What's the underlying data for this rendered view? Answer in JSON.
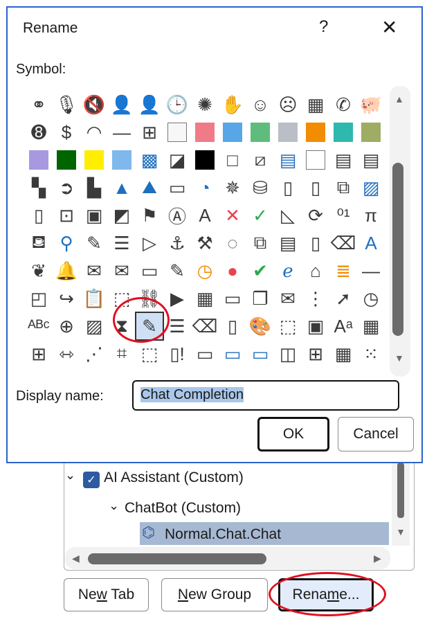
{
  "dialog": {
    "title": "Rename",
    "help": "?",
    "close": "✕",
    "symbol_label": "Symbol:",
    "display_name_label": "Display name:",
    "display_name_value": "Chat Completion",
    "ok": "OK",
    "cancel": "Cancel"
  },
  "symbols": [
    [
      "circles",
      "microphone",
      "mute",
      "user",
      "user-outline",
      "clock",
      "sparkle",
      "hand",
      "smile",
      "sad",
      "calculator",
      "phone",
      "piggy-bank"
    ],
    [
      "eight-ball",
      "quote-dollar",
      "eye",
      "dash",
      "four-squares",
      "#f7f7f7",
      "#f07b88",
      "#56a6e8",
      "#5ebd7d",
      "#b9bec7",
      "#f28c00",
      "#2fb8ad",
      "#9fac63"
    ],
    [
      "#a898e0",
      "#006400",
      "#ffee00",
      "#7fb8ec",
      "blue-pattern",
      "contrast",
      "#000000",
      "white-bordered",
      "diagonal",
      "gradient",
      "#ffffff",
      "gray-stripes",
      "gray-stripes"
    ],
    [
      "checker",
      "arrow-circle",
      "bar-chart",
      "cone",
      "mountains",
      "rects",
      "pie",
      "radar",
      "cylinders",
      "notebook",
      "book",
      "cubes",
      "landscape"
    ],
    [
      "page",
      "image-globe",
      "film",
      "stripes",
      "flags",
      "letter-a",
      "letter-a-gray",
      "x-mark",
      "check",
      "ruler",
      "refresh",
      "binary",
      "pi"
    ],
    [
      "paint-bucket",
      "magnifier",
      "brush",
      "list",
      "play",
      "anchor",
      "toolbox",
      "dashed-circle",
      "copy",
      "note-list",
      "page",
      "eraser",
      "letter-a-blue"
    ],
    [
      "butterfly",
      "bell",
      "envelope-open",
      "envelope",
      "contact-card",
      "edit-card",
      "clock-orange",
      "red-circle",
      "green-check",
      "ie",
      "home",
      "stack-orange",
      "dash"
    ],
    [
      "sticky-note",
      "page-arrow",
      "clipboard",
      "cube",
      "link-check",
      "video",
      "table",
      "window",
      "windows",
      "certificate",
      "tree",
      "cursor",
      "calendar-clock"
    ],
    [
      "abc",
      "zoom-in",
      "picture",
      "hourglass",
      "pencil-box",
      "lines",
      "eraser",
      "mouse",
      "palette",
      "dotted-frame",
      "window-chart",
      "superscript",
      "table-green"
    ],
    [
      "align-h",
      "distribute",
      "connector",
      "crop",
      "select",
      "page-red",
      "frame",
      "frame-blue",
      "frame-blue",
      "panel",
      "grid4",
      "grid9",
      "dot-grid"
    ]
  ],
  "selected_symbol": "pencil-box",
  "tree": {
    "items": [
      {
        "label": "AI Assistant (Custom)",
        "checked": true
      },
      {
        "label": "ChatBot (Custom)"
      },
      {
        "label": "Normal.Chat.Chat"
      }
    ]
  },
  "buttons": {
    "new_tab": [
      "Ne",
      "w",
      " Tab"
    ],
    "new_group": [
      "",
      "N",
      "ew Group"
    ],
    "rename": [
      "Rena",
      "m",
      "e..."
    ]
  }
}
